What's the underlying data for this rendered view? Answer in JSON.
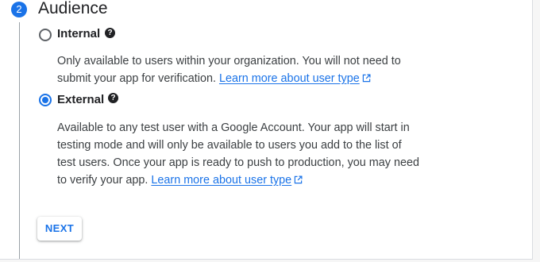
{
  "step": {
    "number": "2",
    "title": "Audience"
  },
  "options": [
    {
      "label": "Internal",
      "selected": false,
      "description": "Only available to users within your organization. You will not need to submit your app for verification.",
      "link_text": "Learn more about user type"
    },
    {
      "label": "External",
      "selected": true,
      "description": "Available to any test user with a Google Account. Your app will start in testing mode and will only be available to users you add to the list of test users. Once your app is ready to push to production, you may need to verify your app.",
      "link_text": "Learn more about user type"
    }
  ],
  "help_icon_glyph": "?",
  "next_button": {
    "label": "NEXT"
  },
  "colors": {
    "accent": "#1a73e8",
    "text": "#202124",
    "secondary_text": "#3c4043",
    "rail": "#9aa0a6"
  },
  "icons": {
    "help": "help-circle-icon",
    "external_link": "open-in-new-icon"
  }
}
